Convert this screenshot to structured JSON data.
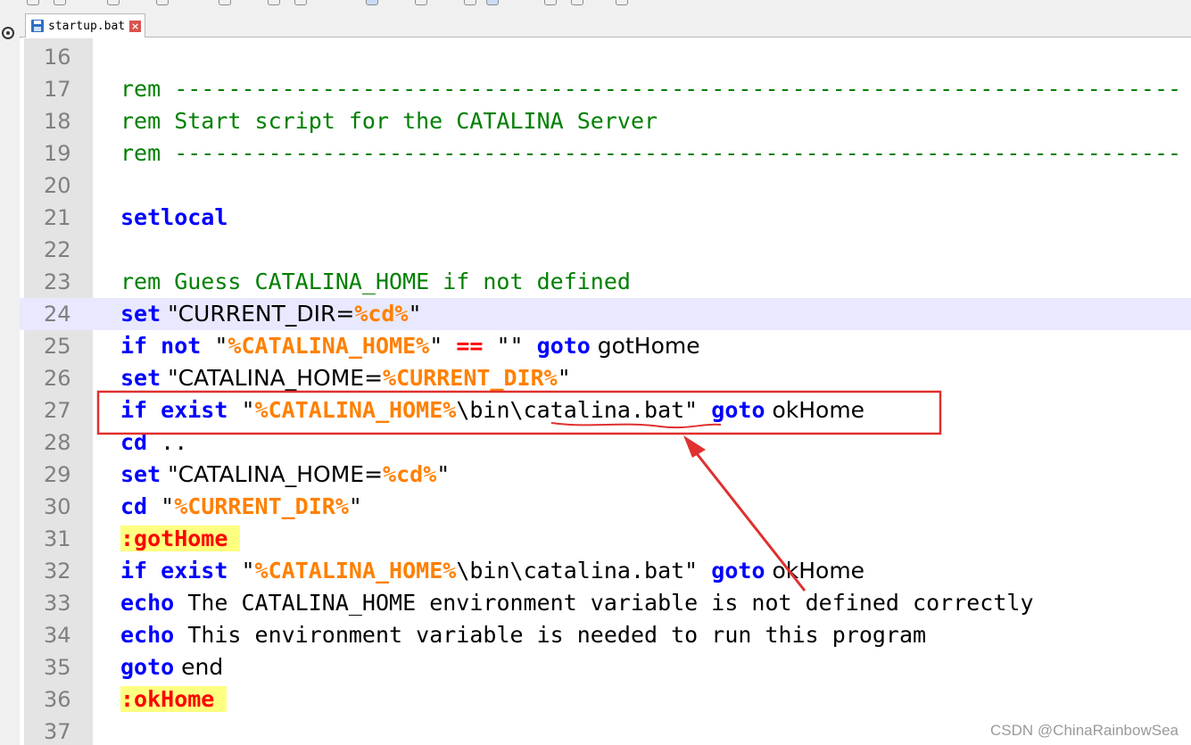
{
  "tab": {
    "label": "startup.bat",
    "close_glyph": "×",
    "icon": "save-icon"
  },
  "editor": {
    "lines": [
      {
        "num": "16",
        "parts": []
      },
      {
        "num": "17",
        "parts": [
          {
            "cls": "cmt",
            "text": "rem ---------------------------------------------------------------------------"
          }
        ]
      },
      {
        "num": "18",
        "parts": [
          {
            "cls": "cmt",
            "text": "rem Start script for the CATALINA Server"
          }
        ]
      },
      {
        "num": "19",
        "parts": [
          {
            "cls": "cmt",
            "text": "rem ---------------------------------------------------------------------------"
          }
        ]
      },
      {
        "num": "20",
        "parts": []
      },
      {
        "num": "21",
        "parts": [
          {
            "cls": "kw",
            "text": "setlocal"
          }
        ]
      },
      {
        "num": "22",
        "parts": []
      },
      {
        "num": "23",
        "parts": [
          {
            "cls": "cmt",
            "text": "rem Guess CATALINA_HOME if not defined"
          }
        ]
      },
      {
        "num": "24",
        "current": true,
        "parts": [
          {
            "cls": "kw",
            "text": "set"
          },
          {
            "cls": "txt wide",
            "text": " \"CURRENT_DIR="
          },
          {
            "cls": "var",
            "text": "%cd%"
          },
          {
            "cls": "txt",
            "text": "\""
          }
        ]
      },
      {
        "num": "25",
        "parts": [
          {
            "cls": "kw",
            "text": "if not"
          },
          {
            "cls": "txt",
            "text": " \""
          },
          {
            "cls": "var",
            "text": "%CATALINA_HOME%"
          },
          {
            "cls": "txt",
            "text": "\" "
          },
          {
            "cls": "op",
            "text": "=="
          },
          {
            "cls": "txt",
            "text": " \"\" "
          },
          {
            "cls": "kw",
            "text": "goto"
          },
          {
            "cls": "txt wide",
            "text": " gotHome"
          }
        ]
      },
      {
        "num": "26",
        "parts": [
          {
            "cls": "kw",
            "text": "set"
          },
          {
            "cls": "txt wide",
            "text": " \"CATALINA_HOME="
          },
          {
            "cls": "var",
            "text": "%CURRENT_DIR%"
          },
          {
            "cls": "txt",
            "text": "\""
          }
        ]
      },
      {
        "num": "27",
        "parts": [
          {
            "cls": "kw",
            "text": "if exist"
          },
          {
            "cls": "txt",
            "text": " \""
          },
          {
            "cls": "var",
            "text": "%CATALINA_HOME%"
          },
          {
            "cls": "txt",
            "text": "\\bin\\catalina.bat\" "
          },
          {
            "cls": "kw",
            "text": "goto"
          },
          {
            "cls": "txt wide",
            "text": " okHome"
          }
        ]
      },
      {
        "num": "28",
        "parts": [
          {
            "cls": "kw",
            "text": "cd"
          },
          {
            "cls": "txt",
            "text": " .."
          }
        ]
      },
      {
        "num": "29",
        "parts": [
          {
            "cls": "kw",
            "text": "set"
          },
          {
            "cls": "txt wide",
            "text": " \"CATALINA_HOME="
          },
          {
            "cls": "var",
            "text": "%cd%"
          },
          {
            "cls": "txt",
            "text": "\""
          }
        ]
      },
      {
        "num": "30",
        "parts": [
          {
            "cls": "kw",
            "text": "cd"
          },
          {
            "cls": "txt",
            "text": " \""
          },
          {
            "cls": "var",
            "text": "%CURRENT_DIR%"
          },
          {
            "cls": "txt",
            "text": "\""
          }
        ]
      },
      {
        "num": "31",
        "parts": [
          {
            "cls": "lbl",
            "text": ":gotHome"
          }
        ]
      },
      {
        "num": "32",
        "parts": [
          {
            "cls": "kw",
            "text": "if exist"
          },
          {
            "cls": "txt",
            "text": " \""
          },
          {
            "cls": "var",
            "text": "%CATALINA_HOME%"
          },
          {
            "cls": "txt",
            "text": "\\bin\\catalina.bat\" "
          },
          {
            "cls": "kw",
            "text": "goto"
          },
          {
            "cls": "txt wide",
            "text": " okHome"
          }
        ]
      },
      {
        "num": "33",
        "parts": [
          {
            "cls": "kw",
            "text": "echo"
          },
          {
            "cls": "txt",
            "text": " The CATALINA_HOME environment variable is not defined correctly"
          }
        ]
      },
      {
        "num": "34",
        "parts": [
          {
            "cls": "kw",
            "text": "echo"
          },
          {
            "cls": "txt",
            "text": " This environment variable is needed to run this program"
          }
        ]
      },
      {
        "num": "35",
        "parts": [
          {
            "cls": "kw",
            "text": "goto"
          },
          {
            "cls": "txt wide",
            "text": " end"
          }
        ]
      },
      {
        "num": "36",
        "parts": [
          {
            "cls": "lbl",
            "text": ":okHome"
          }
        ]
      },
      {
        "num": "37",
        "parts": []
      }
    ]
  },
  "annotation": {
    "highlighted_line": "27",
    "box_color": "#e03030",
    "arrow_color": "#e03030"
  },
  "watermark": "CSDN @ChinaRainbowSea",
  "colors": {
    "comment": "#008000",
    "keyword": "#0000ff",
    "variable": "#ff8000",
    "operator": "#ff0000",
    "label_bg": "#ffff80",
    "current_line": "#e8e8ff",
    "gutter": "#e4e4e4"
  }
}
